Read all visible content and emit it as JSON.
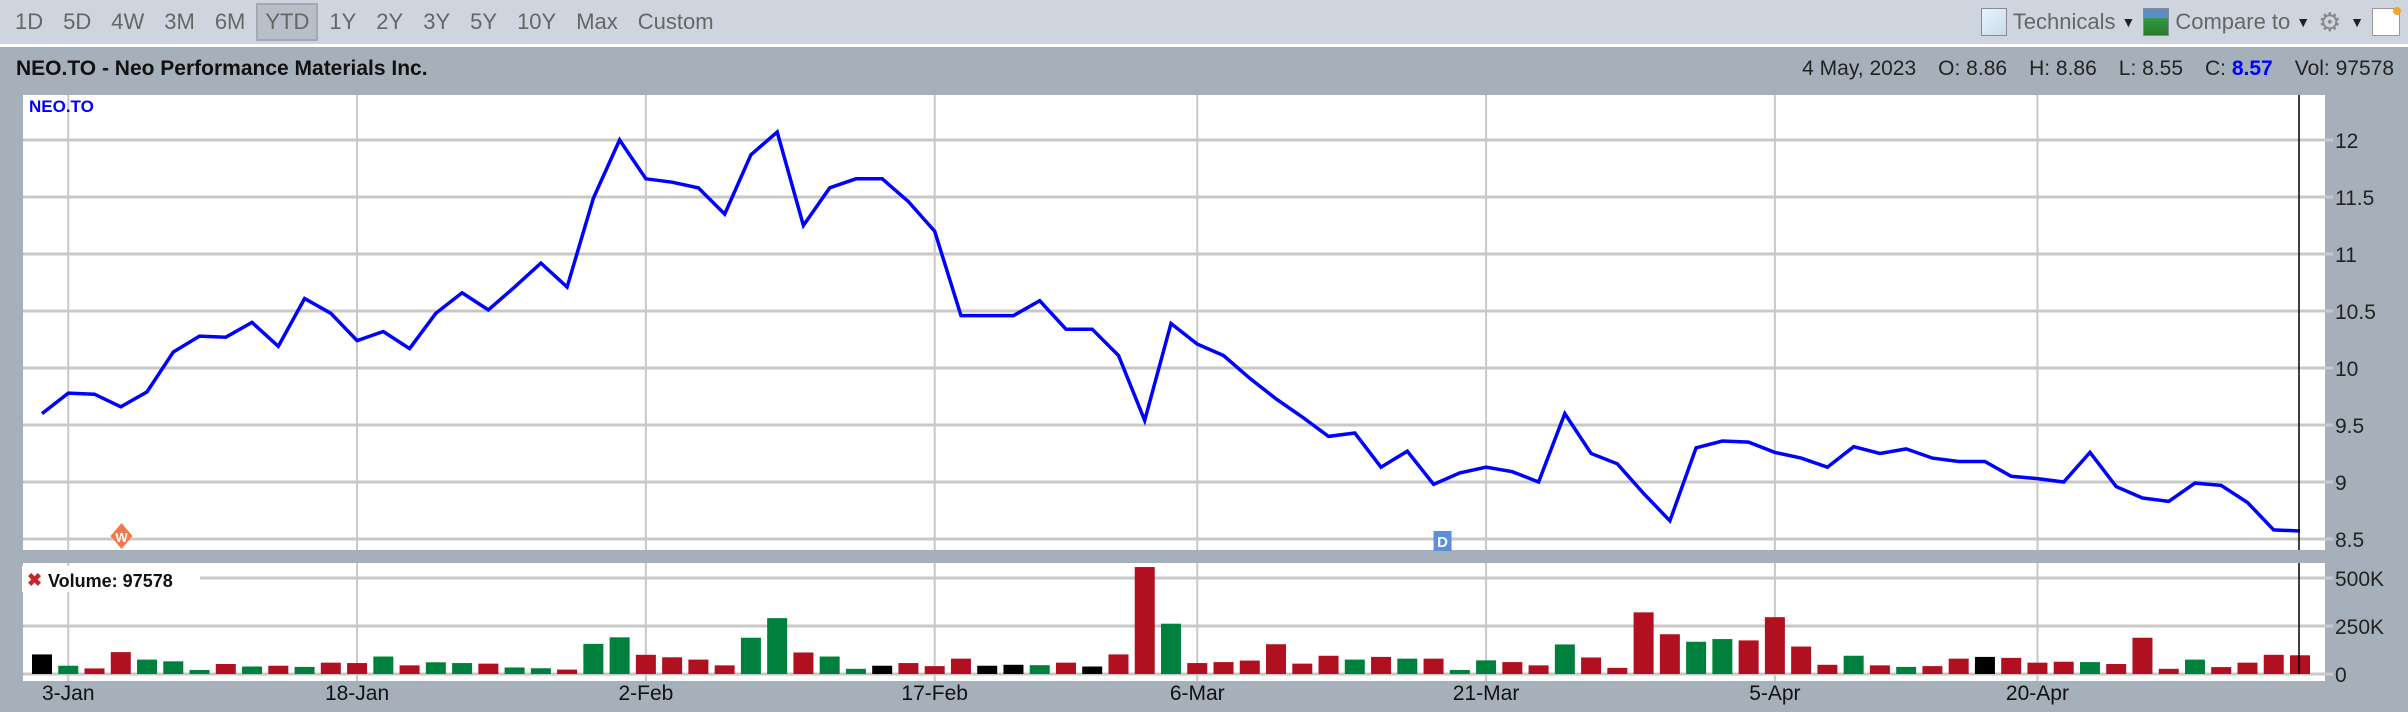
{
  "toolbar": {
    "ranges": [
      "1D",
      "5D",
      "4W",
      "3M",
      "6M",
      "YTD",
      "1Y",
      "2Y",
      "3Y",
      "5Y",
      "10Y",
      "Max",
      "Custom"
    ],
    "selected_range": "YTD",
    "technicals_label": "Technicals",
    "compare_label": "Compare to"
  },
  "header": {
    "title": "NEO.TO - Neo Performance Materials Inc.",
    "date": "4 May, 2023",
    "open": "O: 8.86",
    "high": "H: 8.86",
    "low": "L: 8.55",
    "close_label": "C:",
    "close_value": "8.57",
    "volume": "Vol: 97578"
  },
  "colors": {
    "line": "#0000ff",
    "up": "#00803d",
    "down": "#b01020",
    "flat": "#000000"
  },
  "chart_data": [
    {
      "type": "line",
      "title": "NEO.TO",
      "series_label": "NEO.TO",
      "ylim": [
        8.4,
        12.3
      ],
      "yticks": [
        "8.5",
        "9",
        "9.5",
        "10",
        "10.5",
        "11",
        "11.5",
        "12"
      ],
      "values": [
        9.6,
        9.78,
        9.77,
        9.66,
        9.79,
        10.14,
        10.28,
        10.27,
        10.4,
        10.19,
        10.61,
        10.48,
        10.24,
        10.32,
        10.17,
        10.48,
        10.66,
        10.51,
        10.71,
        10.92,
        10.71,
        11.49,
        12.0,
        11.66,
        11.63,
        11.58,
        11.35,
        11.87,
        12.07,
        11.25,
        11.58,
        11.66,
        11.66,
        11.46,
        11.2,
        10.46,
        10.46,
        10.46,
        10.59,
        10.34,
        10.34,
        10.11,
        9.54,
        10.39,
        10.21,
        10.11,
        9.91,
        9.73,
        9.57,
        9.4,
        9.43,
        9.13,
        9.27,
        8.98,
        9.08,
        9.13,
        9.09,
        9.0,
        9.6,
        9.25,
        9.16,
        8.9,
        8.66,
        9.3,
        9.36,
        9.35,
        9.26,
        9.21,
        9.13,
        9.31,
        9.25,
        9.29,
        9.21,
        9.18,
        9.18,
        9.05,
        9.03,
        9.0,
        9.26,
        8.96,
        8.86,
        8.83,
        8.99,
        8.97,
        8.82,
        8.58,
        8.57
      ],
      "xticks": [
        {
          "label": "3-Jan",
          "index": 1
        },
        {
          "label": "18-Jan",
          "index": 12
        },
        {
          "label": "2-Feb",
          "index": 23
        },
        {
          "label": "17-Feb",
          "index": 34
        },
        {
          "label": "6-Mar",
          "index": 44
        },
        {
          "label": "21-Mar",
          "index": 55
        },
        {
          "label": "5-Apr",
          "index": 66
        },
        {
          "label": "20-Apr",
          "index": 76
        }
      ],
      "events": [
        {
          "label": "W",
          "index": 2
        },
        {
          "label": "D",
          "index": 53
        }
      ]
    },
    {
      "type": "bar",
      "title": "Volume: 97578",
      "ylim": [
        0,
        560000
      ],
      "yticks": [
        {
          "label": "0",
          "value": 0
        },
        {
          "label": "250K",
          "value": 250000
        },
        {
          "label": "500K",
          "value": 500000
        }
      ],
      "values": [
        102000,
        43000,
        29000,
        114000,
        75000,
        66000,
        21000,
        52000,
        39000,
        43000,
        37000,
        59000,
        57000,
        91000,
        45000,
        61000,
        57000,
        54000,
        34000,
        30000,
        23000,
        157000,
        191000,
        100000,
        87000,
        75000,
        45000,
        189000,
        291000,
        112000,
        91000,
        27000,
        43000,
        57000,
        41000,
        80000,
        43000,
        48000,
        46000,
        59000,
        39000,
        102000,
        557000,
        262000,
        57000,
        62000,
        70000,
        155000,
        54000,
        95000,
        75000,
        89000,
        80000,
        80000,
        21000,
        71000,
        62000,
        45000,
        154000,
        86000,
        32000,
        321000,
        207000,
        168000,
        182000,
        175000,
        296000,
        143000,
        48000,
        95000,
        45000,
        37000,
        41000,
        80000,
        89000,
        84000,
        59000,
        64000,
        62000,
        52000,
        189000,
        27000,
        75000,
        36000,
        59000,
        100000,
        97578
      ],
      "directions": "fudduuudududdudud uudduudddduudud uddddudud dduddd dudududuuddudddduuuddduduuddufddduddddudduddu"
    }
  ]
}
